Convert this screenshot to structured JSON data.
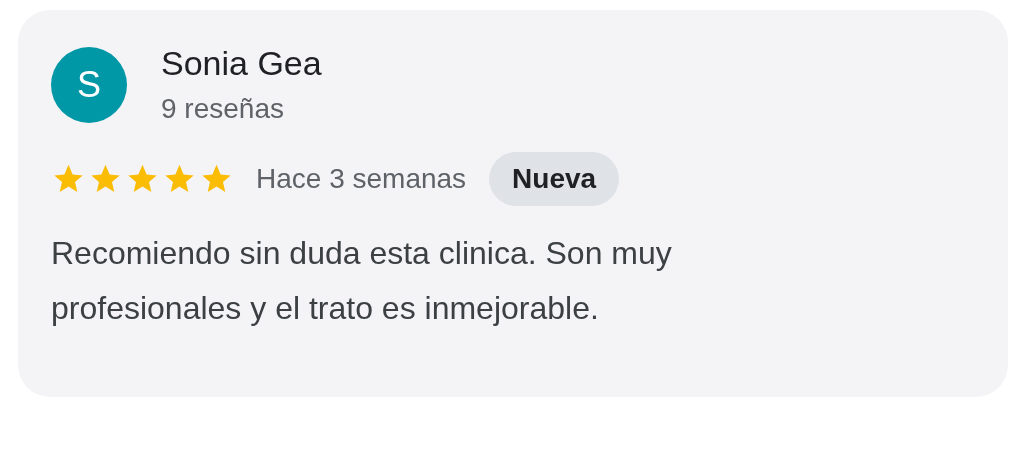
{
  "review": {
    "avatar_letter": "S",
    "author": "Sonia Gea",
    "review_count": "9 reseñas",
    "stars": 5,
    "time": "Hace 3 semanas",
    "badge": "Nueva",
    "text": "Recomiendo sin duda esta clinica. Son muy profesionales y el trato es inmejorable."
  }
}
